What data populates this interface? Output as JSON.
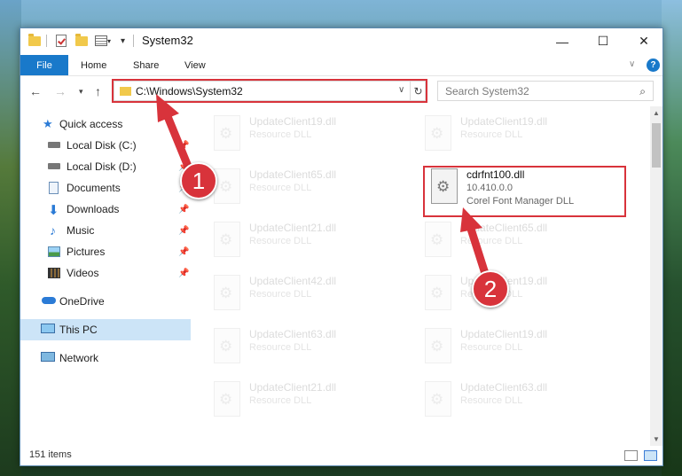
{
  "window": {
    "title": "System32",
    "controls": {
      "minimize": "—",
      "maximize": "☐",
      "close": "✕"
    }
  },
  "ribbon": {
    "tabs": [
      {
        "label": "File"
      },
      {
        "label": "Home"
      },
      {
        "label": "Share"
      },
      {
        "label": "View"
      }
    ],
    "help": "?"
  },
  "nav": {
    "address": "C:\\Windows\\System32",
    "search_placeholder": "Search System32"
  },
  "sidebar": {
    "items": [
      {
        "label": "Quick access",
        "icon": "star-icon"
      },
      {
        "label": "Local Disk (C:)",
        "icon": "drive-icon"
      },
      {
        "label": "Local Disk (D:)",
        "icon": "drive-icon"
      },
      {
        "label": "Documents",
        "icon": "documents-icon"
      },
      {
        "label": "Downloads",
        "icon": "download-icon"
      },
      {
        "label": "Music",
        "icon": "music-icon"
      },
      {
        "label": "Pictures",
        "icon": "pictures-icon"
      },
      {
        "label": "Videos",
        "icon": "videos-icon"
      },
      {
        "label": "OneDrive",
        "icon": "cloud-icon"
      },
      {
        "label": "This PC",
        "icon": "computer-icon"
      },
      {
        "label": "Network",
        "icon": "network-icon"
      }
    ]
  },
  "files": {
    "left": [
      {
        "name": "UpdateClient19.dll",
        "desc": "Resource DLL"
      },
      {
        "name": "UpdateClient65.dll",
        "desc": "Resource DLL"
      },
      {
        "name": "UpdateClient21.dll",
        "desc": "Resource DLL"
      },
      {
        "name": "UpdateClient42.dll",
        "desc": "Resource DLL"
      },
      {
        "name": "UpdateClient63.dll",
        "desc": "Resource DLL"
      },
      {
        "name": "UpdateClient21.dll",
        "desc": "Resource DLL"
      }
    ],
    "right": [
      {
        "name": "UpdateClient19.dll",
        "desc": "Resource DLL"
      },
      {
        "name": "UpdateClient65.dll",
        "desc": "Resource DLL"
      },
      {
        "name": "UpdateClient19.dll",
        "desc": "Resource DLL"
      },
      {
        "name": "UpdateClient19.dll",
        "desc": "Resource DLL"
      },
      {
        "name": "UpdateClient63.dll",
        "desc": "Resource DLL"
      }
    ],
    "target": {
      "name": "cdrfnt100.dll",
      "version": "10.410.0.0",
      "desc": "Corel Font Manager DLL"
    }
  },
  "status": {
    "count": "151 items"
  },
  "annotations": {
    "step1": "1",
    "step2": "2",
    "color": "#d8333b"
  }
}
